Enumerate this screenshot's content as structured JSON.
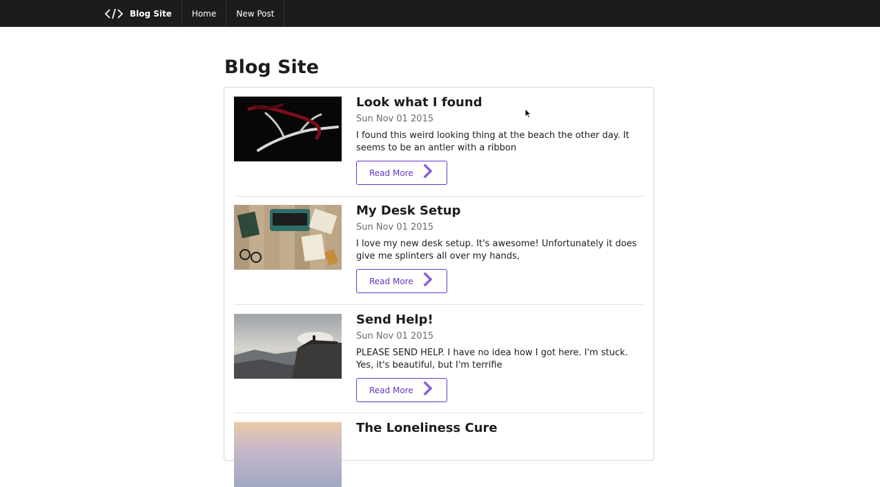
{
  "nav": {
    "brand_label": "Blog Site",
    "brand_icon": "code-icon",
    "items": [
      {
        "label": "Home"
      },
      {
        "label": "New Post"
      }
    ]
  },
  "page": {
    "title": "Blog Site"
  },
  "posts": [
    {
      "title": "Look what I found",
      "date": "Sun Nov 01 2015",
      "excerpt": "I found this weird looking thing at the beach the other day. It seems to be an antler with a ribbon",
      "button_label": "Read More",
      "image": "antler-with-red-ribbon"
    },
    {
      "title": "My Desk Setup",
      "date": "Sun Nov 01 2015",
      "excerpt": "I love my new desk setup. It's awesome! Unfortunately it does give me splinters all over my hands,",
      "button_label": "Read More",
      "image": "typewriter-on-wooden-desk"
    },
    {
      "title": "Send Help!",
      "date": "Sun Nov 01 2015",
      "excerpt": "PLEASE SEND HELP. I have no idea how I got here. I'm stuck. Yes, it's beautiful, but I'm terrifie",
      "button_label": "Read More",
      "image": "person-on-cliff-edge"
    },
    {
      "title": "The Loneliness Cure",
      "image": "pastel-sky"
    }
  ],
  "colors": {
    "topbar": "#1b1c1d",
    "accent": "#6435c9"
  }
}
